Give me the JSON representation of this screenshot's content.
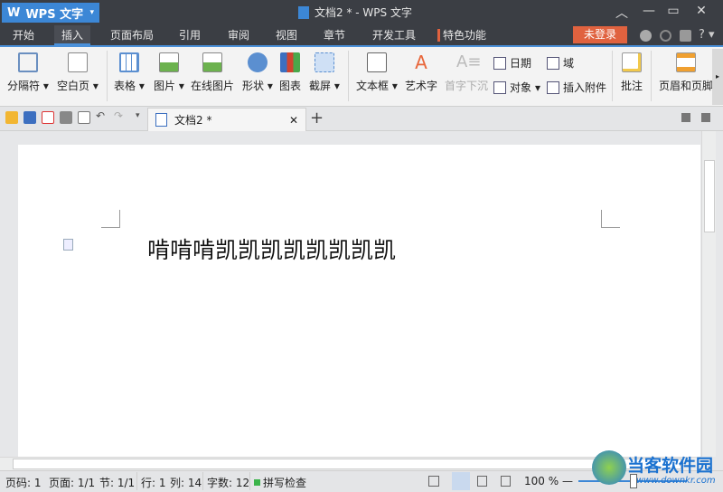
{
  "app": {
    "name": "WPS 文字",
    "doc_title": "文档2 * - WPS 文字"
  },
  "menu": [
    "开始",
    "插入",
    "页面布局",
    "引用",
    "审阅",
    "视图",
    "章节",
    "开发工具",
    "特色功能"
  ],
  "login": "未登录",
  "help": "?",
  "ribbon": {
    "big": [
      "分隔符",
      "空白页",
      "表格",
      "图片",
      "在线图片",
      "形状",
      "图表",
      "截屏",
      "文本框",
      "艺术字",
      "首字下沉",
      "批注",
      "页眉和页脚"
    ],
    "small": [
      "日期",
      "域",
      "对象",
      "插入附件"
    ]
  },
  "doc_tab": {
    "label": "文档2 *",
    "new_tab": "+"
  },
  "document": {
    "text": "啃啃啃凯凯凯凯凯凯凯凯"
  },
  "status": {
    "page_num": "页码: 1",
    "pages": "页面: 1/1",
    "section": "节: 1/1",
    "row": "行: 1",
    "col": "列: 14",
    "words": "字数: 12",
    "spell": "拼写检查",
    "zoom": "100 %"
  },
  "watermark": {
    "name": "当客软件园",
    "url": "www.downkr.com"
  },
  "colors": {
    "accent": "#4a90d9",
    "login": "#e0623f",
    "titlebar": "#3b3e44"
  }
}
